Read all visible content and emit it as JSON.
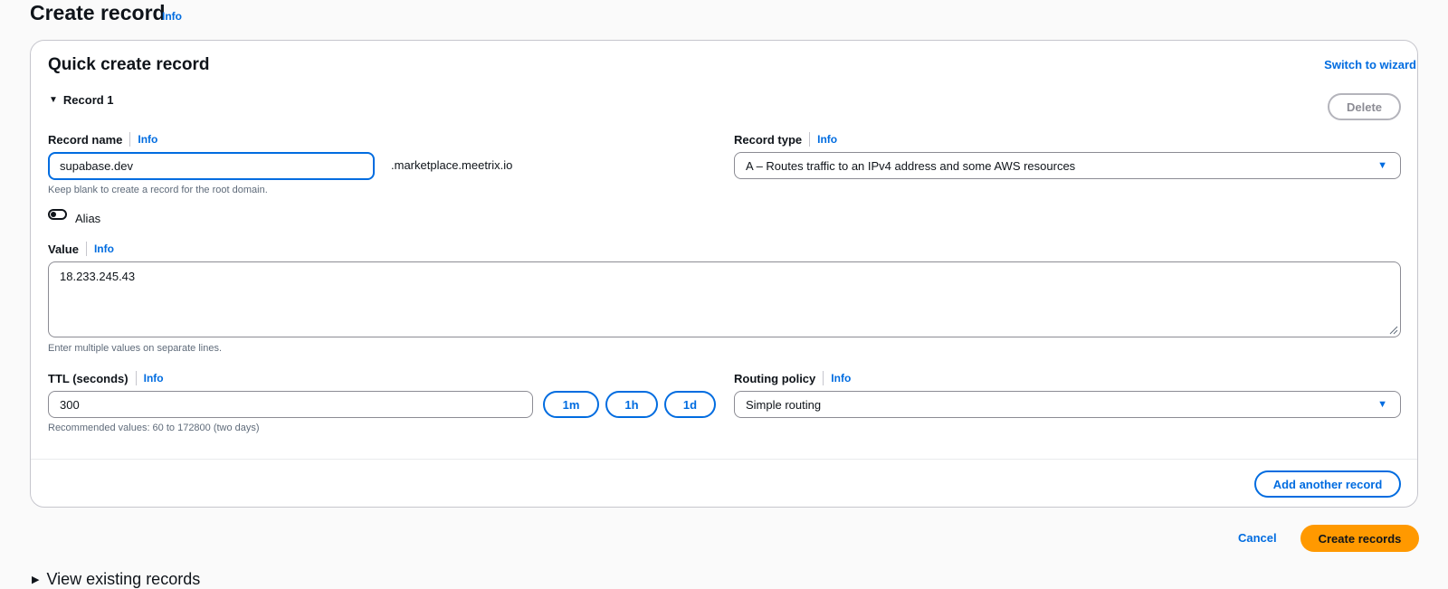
{
  "page": {
    "title": "Create record",
    "info": "Info"
  },
  "panel": {
    "title": "Quick create record",
    "switch_link": "Switch to wizard",
    "record_header": "Record 1",
    "delete_label": "Delete"
  },
  "record_name": {
    "label": "Record name",
    "info": "Info",
    "value": "supabase.dev",
    "suffix": ".marketplace.meetrix.io",
    "hint": "Keep blank to create a record for the root domain."
  },
  "record_type": {
    "label": "Record type",
    "info": "Info",
    "value": "A – Routes traffic to an IPv4 address and some AWS resources"
  },
  "alias": {
    "label": "Alias"
  },
  "value_field": {
    "label": "Value",
    "info": "Info",
    "value": "18.233.245.43",
    "hint": "Enter multiple values on separate lines."
  },
  "ttl": {
    "label": "TTL (seconds)",
    "info": "Info",
    "value": "300",
    "hint": "Recommended values: 60 to 172800 (two days)",
    "presets": [
      "1m",
      "1h",
      "1d"
    ]
  },
  "routing_policy": {
    "label": "Routing policy",
    "info": "Info",
    "value": "Simple routing"
  },
  "add_another_label": "Add another record",
  "footer": {
    "cancel": "Cancel",
    "create": "Create records"
  },
  "view_existing": "View existing records",
  "colors": {
    "accent": "#006ce0",
    "primary_button": "#ff9900"
  }
}
